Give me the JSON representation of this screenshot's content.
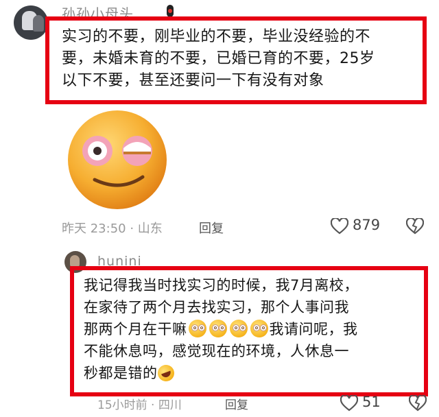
{
  "comment1": {
    "username": "孙孙小母头",
    "text_lines": [
      "实习的不要，刚毕业的不要，毕业没经验的不",
      "要，未婚未育的不要，已婚已育的不要，25岁",
      "以下不要，甚至还要问一下有没有对象"
    ],
    "sticker": "smirking-emoji-sticker",
    "time": "昨天 23:50",
    "location": "山东",
    "reply_label": "回复",
    "like_count": "879"
  },
  "comment2": {
    "username": "hunini",
    "line1": "我记得我当时找实习的时候，我7月离校，",
    "line2": "在家待了两个月去找实习，那个人事问我",
    "line3_a": "那两个月在干嘛",
    "line3_b": "我请问呢，我",
    "line4": "不能休息吗，感觉现在的环境，人休息一",
    "line5": "秒都是错的",
    "time": "15小时前",
    "location": "四川",
    "reply_label": "回复",
    "like_count": "51"
  },
  "colors": {
    "highlight": "#e60012",
    "meta": "#9a9a9a"
  }
}
